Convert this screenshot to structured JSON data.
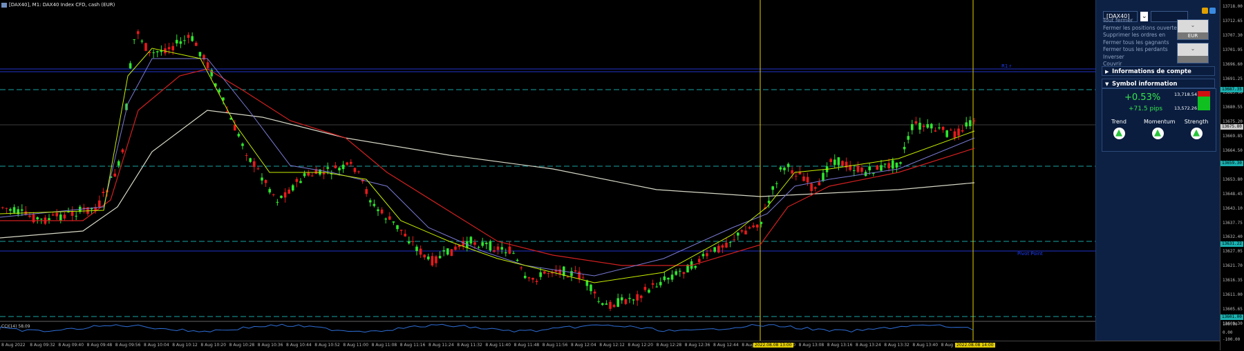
{
  "window": {
    "title": "[DAX40], M1: DAX40 Index CFD, cash (EUR)"
  },
  "chart": {
    "colors": {
      "bull": "#2ee62e",
      "bear": "#e81a1a",
      "ma_fast": "#c8f000",
      "ma_slow": "#7b7bd6",
      "ma_red": "#d42020",
      "ma_white": "#d8d8c8",
      "level": "#1aa3a3",
      "vline": "#e6d000",
      "blue_line": "#2233cc"
    },
    "labels": {
      "r1": "R1 r",
      "pivot": "Pivot Point"
    },
    "oscillator_label": "CCI(14) 58.09"
  },
  "price_axis": {
    "ticks": [
      "13718.00",
      "13712.65",
      "13707.30",
      "13701.95",
      "13696.60",
      "13691.25",
      "13685.90",
      "13680.55",
      "13675.20",
      "13669.85",
      "13664.50",
      "13659.15",
      "13653.80",
      "13648.45",
      "13643.10",
      "13637.75",
      "13632.40",
      "13627.05",
      "13621.70",
      "13616.35",
      "13611.00",
      "13605.65",
      "13600.30"
    ],
    "tags": [
      {
        "text": "13687.35",
        "color": "#1ab0b0"
      },
      {
        "text": "13675.80",
        "color": "#c8c8c8"
      },
      {
        "text": "13659.30",
        "color": "#1ab0b0"
      },
      {
        "text": "13631.22",
        "color": "#1ab0b0"
      },
      {
        "text": "13601.00",
        "color": "#1ab0b0"
      }
    ],
    "osc_ticks": [
      "100.00",
      "0.00",
      "-100.00"
    ]
  },
  "time_axis": {
    "labels": [
      "8 Aug 2022",
      "8 Aug 09:32",
      "8 Aug 09:40",
      "8 Aug 09:48",
      "8 Aug 09:56",
      "8 Aug 10:04",
      "8 Aug 10:12",
      "8 Aug 10:20",
      "8 Aug 10:28",
      "8 Aug 10:36",
      "8 Aug 10:44",
      "8 Aug 10:52",
      "8 Aug 11:00",
      "8 Aug 11:08",
      "8 Aug 11:16",
      "8 Aug 11:24",
      "8 Aug 11:32",
      "8 Aug 11:40",
      "8 Aug 11:48",
      "8 Aug 11:56",
      "8 Aug 12:04",
      "8 Aug 12:12",
      "8 Aug 12:20",
      "8 Aug 12:28",
      "8 Aug 12:36",
      "8 Aug 12:44",
      "8 Aug 12:52",
      "8 Aug 13:00",
      "8 Aug 13:08",
      "8 Aug 13:16",
      "8 Aug 13:24",
      "8 Aug 13:32",
      "8 Aug 13:40",
      "8 Aug 13:48",
      "8 Aug 13:56"
    ],
    "highlights": [
      "2022.08.08 13:00",
      "2022.08.08 14:00"
    ]
  },
  "panel": {
    "symbol": "[DAX40]",
    "menu": [
      "Tout fermer",
      "Fermer les positions ouvertes",
      "Supprimer les ordres en",
      "Fermer tous les gagnants",
      "Fermer tous les perdants",
      "Inverser",
      "Couvrir"
    ],
    "spin1": {
      "top": "",
      "bottom": "EUR"
    },
    "spin2": {
      "top": "",
      "bottom": ""
    },
    "account_header": "Informations de compte",
    "symbol_header": "Symbol information",
    "change_pct": "+0.53%",
    "change_pips": "+71.5 pips",
    "high": "13,718.54",
    "low": "13,572.26",
    "indicators": [
      {
        "label": "Trend"
      },
      {
        "label": "Momentum"
      },
      {
        "label": "Strength"
      }
    ]
  }
}
